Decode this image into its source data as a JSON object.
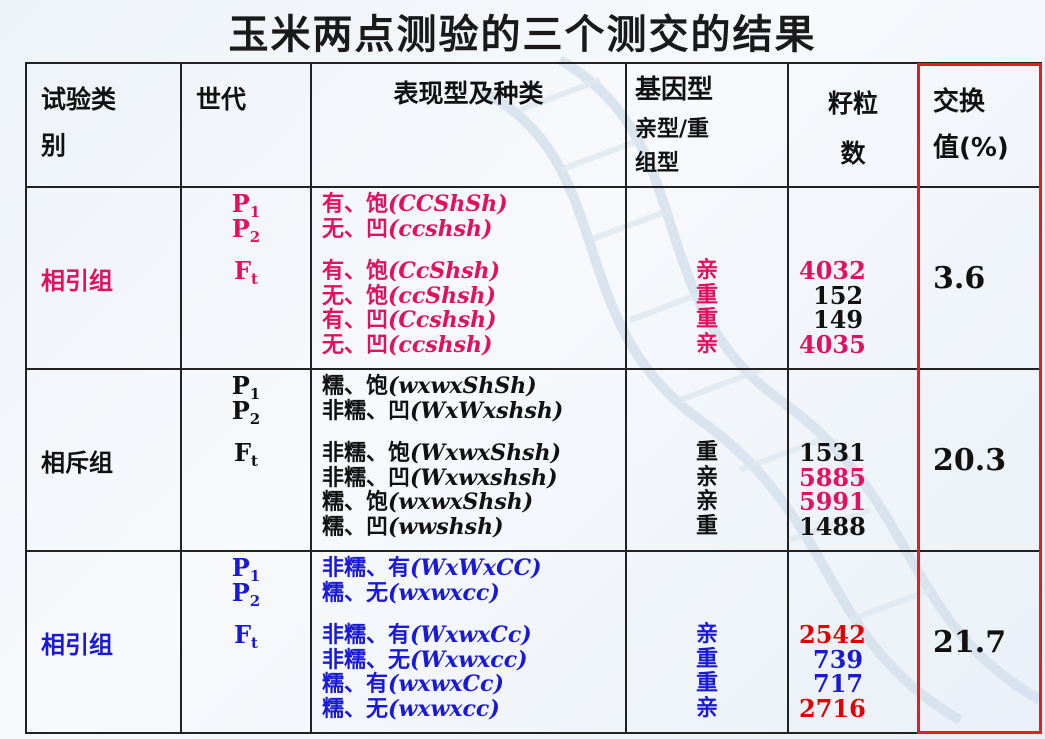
{
  "title": "玉米两点测验的三个测交的结果",
  "headers": {
    "type": [
      "试验类",
      "别"
    ],
    "generation": "世代",
    "phenotype": "表现型及种类",
    "genotype": [
      "基因型",
      "亲型/重",
      "组型"
    ],
    "seeds": [
      "籽粒",
      "数"
    ],
    "exchange": [
      "交换",
      "值(%)"
    ]
  },
  "colors": {
    "pink": "#e0115f",
    "blue": "#1a1ad6",
    "red": "#e00000",
    "highlight": "#e02020"
  },
  "groups": [
    {
      "name": "相引组",
      "gen_labels": [
        "P",
        "1",
        "P",
        "2",
        "F",
        "t"
      ],
      "parents": [
        {
          "text": "有、饱",
          "genotype": "(CCShSh)"
        },
        {
          "text": "无、凹",
          "genotype": "(ccshsh)"
        }
      ],
      "ft": [
        {
          "text": "有、饱",
          "genotype": "(CcShsh)",
          "type": "亲",
          "count": "4032"
        },
        {
          "text": "无、饱",
          "genotype": "(ccShsh)",
          "type": "重",
          "count": "152"
        },
        {
          "text": "有、凹",
          "genotype": "(Ccshsh)",
          "type": "重",
          "count": "149"
        },
        {
          "text": "无、凹",
          "genotype": "(ccshsh)",
          "type": "亲",
          "count": "4035"
        }
      ],
      "exchange": "3.6"
    },
    {
      "name": "相斥组",
      "gen_labels": [
        "P",
        "1",
        "P",
        "2",
        "F",
        "t"
      ],
      "parents": [
        {
          "text": "糯、饱",
          "genotype": "(wxwxShSh)"
        },
        {
          "text": "非糯、凹",
          "genotype": "(WxWxshsh)"
        }
      ],
      "ft": [
        {
          "text": "非糯、饱",
          "genotype": "(WxwxShsh)",
          "type": "重",
          "count": "1531"
        },
        {
          "text": "非糯、凹",
          "genotype": "(Wxwxshsh)",
          "type": "亲",
          "count": "5885"
        },
        {
          "text": "糯、饱",
          "genotype": "(wxwxShsh)",
          "type": "亲",
          "count": "5991"
        },
        {
          "text": "糯、凹",
          "genotype": "(wwshsh)",
          "type": "重",
          "count": "1488"
        }
      ],
      "exchange": "20.3"
    },
    {
      "name": "相引组",
      "gen_labels": [
        "P",
        "1",
        "P",
        "2",
        "F",
        "t"
      ],
      "parents": [
        {
          "text": "非糯、有",
          "genotype": "(WxWxCC)"
        },
        {
          "text": "糯、无",
          "genotype": "(wxwxcc)"
        }
      ],
      "ft": [
        {
          "text": "非糯、有",
          "genotype": "(WxwxCc)",
          "type": "亲",
          "count": "2542"
        },
        {
          "text": "非糯、无",
          "genotype": "(Wxwxcc)",
          "type": "重",
          "count": "739"
        },
        {
          "text": "糯、有",
          "genotype": "(wxwxCc)",
          "type": "重",
          "count": "717"
        },
        {
          "text": "糯、无",
          "genotype": "(wxwxcc)",
          "type": "亲",
          "count": "2716"
        }
      ],
      "exchange": "21.7"
    }
  ]
}
